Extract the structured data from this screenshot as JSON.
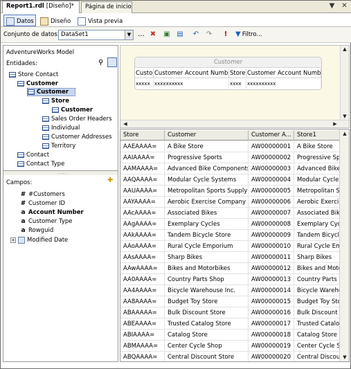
{
  "doc_tabs": [
    {
      "name": "Report1.rdl",
      "state": "[Diseño]*"
    },
    {
      "name": "Página de inicio"
    }
  ],
  "window_buttons": {
    "dropdown": "▼",
    "close": "✕"
  },
  "view_tabs": [
    {
      "label": "Datos"
    },
    {
      "label": "Diseño"
    },
    {
      "label": "Vista previa"
    }
  ],
  "dataset": {
    "label": "Conjunto de datos:",
    "selected": "DataSet1",
    "ellipsis": "...",
    "filter_label": "Filtro..."
  },
  "model": {
    "title": "AdventureWorks Model",
    "entities_label": "Entidades:"
  },
  "entities": [
    "Store Contact",
    "Customer",
    "Customer",
    "Store",
    "Customer",
    "Sales Order Headers",
    "Individual",
    "Customer Addresses",
    "Territory",
    "Contact",
    "Contact Type"
  ],
  "fields": {
    "label": "Campos:",
    "items": [
      {
        "icon": "#",
        "label": "#Customers"
      },
      {
        "icon": "#",
        "label": "Customer ID"
      },
      {
        "icon": "a",
        "label": "Account Number"
      },
      {
        "icon": "a",
        "label": "Customer Type"
      },
      {
        "icon": "a",
        "label": "Rowguid"
      },
      {
        "icon": "calendar",
        "label": "Modified Date"
      }
    ]
  },
  "query_table": {
    "caption": "Customer",
    "headers": [
      "Custo",
      "Customer Account Number",
      "Store",
      "Customer Account Number"
    ],
    "cells": [
      "xxxxx",
      "xxxxxxxxxx",
      "xxxx",
      "xxxxxxxxxx"
    ]
  },
  "results": {
    "columns": [
      "Store",
      "Customer",
      "Customer A...",
      "Store1"
    ],
    "rows": [
      [
        "AAEAAAA=",
        "A Bike Store",
        "AW00000001",
        "A Bike Store"
      ],
      [
        "AAIAAAA=",
        "Progressive Sports",
        "AW00000002",
        "Progressive Sp..."
      ],
      [
        "AAMAAAA=",
        "Advanced Bike Components",
        "AW00000003",
        "Advanced Bike ..."
      ],
      [
        "AAQAAAA=",
        "Modular Cycle Systems",
        "AW00000004",
        "Modular Cycle S..."
      ],
      [
        "AAUAAAA=",
        "Metropolitan Sports Supply",
        "AW00000005",
        "Metropolitan Sp..."
      ],
      [
        "AAYAAAA=",
        "Aerobic Exercise Company",
        "AW00000006",
        "Aerobic Exercis..."
      ],
      [
        "AAcAAAA=",
        "Associated Bikes",
        "AW00000007",
        "Associated Bikes"
      ],
      [
        "AAgAAAA=",
        "Exemplary Cycles",
        "AW00000008",
        "Exemplary Cycles"
      ],
      [
        "AAkAAAA=",
        "Tandem Bicycle Store",
        "AW00000009",
        "Tandem Bicycle S..."
      ],
      [
        "AAoAAAA=",
        "Rural Cycle Emporium",
        "AW00000010",
        "Rural Cycle Em..."
      ],
      [
        "AAsAAAA=",
        "Sharp Bikes",
        "AW00000011",
        "Sharp Bikes"
      ],
      [
        "AAwAAAA=",
        "Bikes and Motorbikes",
        "AW00000012",
        "Bikes and Motor..."
      ],
      [
        "AA0AAAA=",
        "Country Parts Shop",
        "AW00000013",
        "Country Parts S..."
      ],
      [
        "AA4AAAA=",
        "Bicycle Warehouse Inc.",
        "AW00000014",
        "Bicycle Wareho..."
      ],
      [
        "AA8AAAA=",
        "Budget Toy Store",
        "AW00000015",
        "Budget Toy Store"
      ],
      [
        "ABAAAAA=",
        "Bulk Discount Store",
        "AW00000016",
        "Bulk Discount S..."
      ],
      [
        "ABEAAAA=",
        "Trusted Catalog Store",
        "AW00000017",
        "Trusted Catalo..."
      ],
      [
        "ABIAAAA=",
        "Catalog Store",
        "AW00000018",
        "Catalog Store"
      ],
      [
        "ABMAAAA=",
        "Center Cycle Shop",
        "AW00000019",
        "Center Cycle S..."
      ],
      [
        "ABQAAAA=",
        "Central Discount Store",
        "AW00000020",
        "Central Discoun..."
      ]
    ]
  },
  "colors": {
    "accent": "#5b7dbb",
    "selection": "#c7d6ef",
    "query_bg": "#fbf8e5"
  }
}
